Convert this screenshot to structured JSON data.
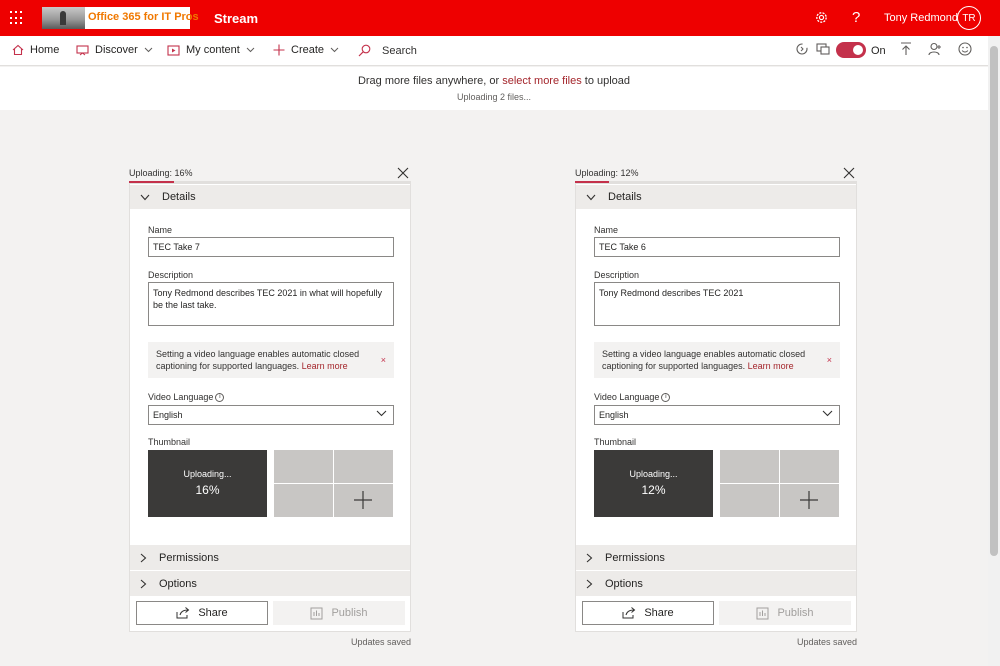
{
  "topbar": {
    "logo_text": "Office 365 for IT Pros",
    "app_title": "Stream",
    "user_name": "Tony Redmond",
    "user_initials": "TR"
  },
  "nav": {
    "home": "Home",
    "discover": "Discover",
    "my_content": "My content",
    "create": "Create",
    "search": "Search",
    "toggle_label": "On"
  },
  "banner": {
    "prefix": "Drag more files anywhere, or ",
    "link": "select more files",
    "suffix": " to upload",
    "status": "Uploading 2 files..."
  },
  "cards": [
    {
      "status": "Uploading: 16%",
      "progress": 0.16,
      "details_label": "Details",
      "name_label": "Name",
      "name_value": "TEC Take 7",
      "description_label": "Description",
      "description_value": "Tony Redmond describes TEC 2021 in what will hopefully be the last take.",
      "info_text": "Setting a video language enables automatic closed captioning for supported languages.",
      "info_link": "Learn more",
      "info_close": "×",
      "language_label": "Video Language",
      "language_value": "English",
      "thumbnail_label": "Thumbnail",
      "thumb_uploading": "Uploading...",
      "thumb_percent": "16%",
      "permissions_label": "Permissions",
      "options_label": "Options",
      "share_label": "Share",
      "publish_label": "Publish",
      "updates": "Updates saved"
    },
    {
      "status": "Uploading: 12%",
      "progress": 0.12,
      "details_label": "Details",
      "name_label": "Name",
      "name_value": "TEC Take 6",
      "description_label": "Description",
      "description_value": "Tony Redmond describes TEC 2021",
      "info_text": "Setting a video language enables automatic closed captioning for supported languages.",
      "info_link": "Learn more",
      "info_close": "×",
      "language_label": "Video Language",
      "language_value": "English",
      "thumbnail_label": "Thumbnail",
      "thumb_uploading": "Uploading...",
      "thumb_percent": "12%",
      "permissions_label": "Permissions",
      "options_label": "Options",
      "share_label": "Share",
      "publish_label": "Publish",
      "updates": "Updates saved"
    }
  ],
  "colors": {
    "topbar": "#ee0000",
    "accent": "#c4314b",
    "link": "#a4262c"
  }
}
